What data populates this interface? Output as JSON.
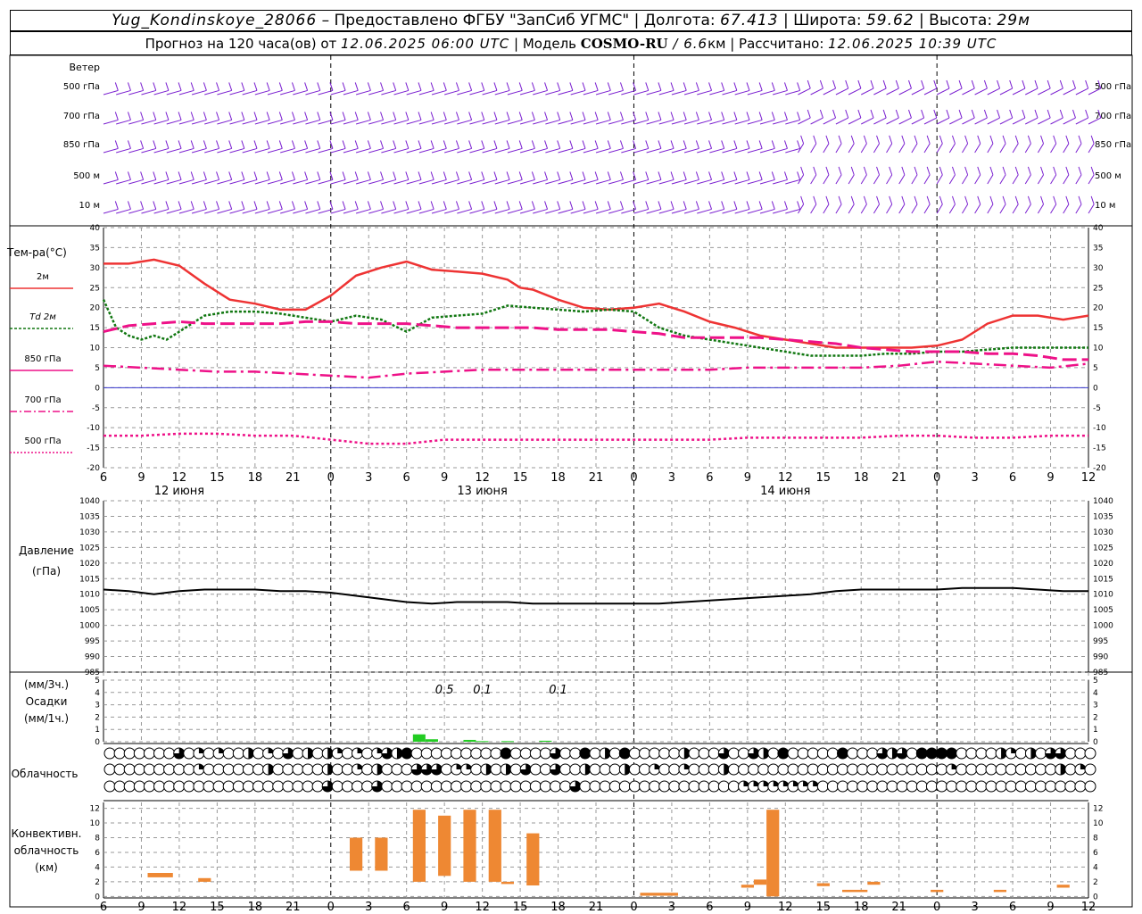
{
  "header": {
    "station": "Yug_Kondinskoye_28066",
    "provider": " – Предоставлено ФГБУ \"ЗапСиб УГМС\" | ",
    "lon_label": "Долгота: ",
    "lon": "67.413",
    "lat_label": " | Широта: ",
    "lat": "59.62",
    "alt_label": " | Высота: ",
    "alt": "29м",
    "forecast_label": "Прогноз на 120 часа(ов) от ",
    "forecast_time": "12.06.2025 06:00 UTC",
    "model_label": " | Модель ",
    "model": "COSMO-RU",
    "resolution": " / 6.6",
    "resolution_unit": "км",
    "calc_label": " | Рассчитано: ",
    "calc_time": "12.06.2025 10:39 UTC"
  },
  "colors": {
    "wind": "#7a1fd0",
    "t2m": "#ee3333",
    "td2m": "#117711",
    "t850": "#ee1188",
    "t700": "#ee1188",
    "t500": "#ee1188",
    "zero": "#3333cc",
    "precip": "#22cc22",
    "conv": "#ee8833",
    "grid": "#999999"
  },
  "labels": {
    "wind_title": "Ветер",
    "wind_levels": [
      "500 гПа",
      "700 гПа",
      "850 гПа",
      "500  м",
      "10  м"
    ],
    "temp_title": "Тем-ра(°C)",
    "legend": [
      "2м",
      "Td  2м",
      "850 гПа",
      "700 гПа",
      "500 гПа"
    ],
    "pressure_title": [
      "Давление",
      "(гПа)"
    ],
    "precip_title": [
      "(мм/3ч.)",
      "Осадки",
      "(мм/1ч.)"
    ],
    "cloud_title": "Облачность",
    "conv_title": [
      "Конвективн.",
      "облачность",
      "(км)"
    ],
    "days": [
      "12 июня",
      "13 июня",
      "14 июня"
    ]
  },
  "chart_data": [
    {
      "type": "line",
      "title": "Тем-ра(°C)",
      "x_hours": [
        0,
        3,
        6,
        9,
        12,
        15,
        18,
        21,
        24,
        27,
        30,
        33,
        36,
        39,
        42,
        45,
        48,
        51,
        54,
        57,
        60,
        63,
        66,
        69,
        72,
        75,
        78
      ],
      "x_ticks": [
        "6",
        "9",
        "12",
        "15",
        "18",
        "21",
        "0",
        "3",
        "6",
        "9",
        "12",
        "15",
        "18",
        "21",
        "0",
        "3",
        "6",
        "9",
        "12",
        "15",
        "18",
        "21",
        "0",
        "3",
        "6",
        "9",
        "12"
      ],
      "ylim": [
        -20,
        40
      ],
      "y_ticks": [
        40,
        35,
        30,
        25,
        20,
        15,
        10,
        5,
        0,
        -5,
        -10,
        -15,
        -20
      ],
      "series": [
        {
          "name": "2м",
          "x": [
            0,
            2,
            4,
            6,
            8,
            10,
            12,
            14,
            16,
            18,
            20,
            22,
            24,
            26,
            28,
            30,
            32,
            33,
            34,
            36,
            38,
            40,
            42,
            44,
            46,
            48,
            50,
            52,
            54,
            56,
            58,
            60,
            62,
            64,
            66,
            68,
            70,
            72,
            74,
            76,
            78
          ],
          "values": [
            31,
            31,
            32,
            30.5,
            26,
            22,
            21,
            19.5,
            19.5,
            23,
            28,
            30,
            31.5,
            29.5,
            29,
            28.5,
            27,
            25,
            24.5,
            22,
            20,
            19.5,
            20,
            21,
            19,
            16.5,
            15,
            13,
            12,
            11,
            10,
            10,
            10,
            10,
            10.5,
            12,
            16,
            18,
            18,
            17,
            18
          ]
        },
        {
          "name": "Td  2м",
          "x": [
            0,
            1,
            2,
            3,
            4,
            5,
            6,
            8,
            10,
            12,
            14,
            16,
            18,
            20,
            22,
            24,
            26,
            28,
            30,
            32,
            34,
            36,
            38,
            40,
            42,
            44,
            46,
            48,
            50,
            52,
            54,
            56,
            58,
            60,
            62,
            64,
            66,
            68,
            70,
            72,
            74,
            76,
            78
          ],
          "values": [
            22,
            15,
            13,
            12,
            13,
            12,
            14,
            18,
            19,
            19,
            18.5,
            17.5,
            16.5,
            18,
            17,
            14,
            17.5,
            18,
            18.5,
            20.5,
            20,
            19.5,
            19,
            19.5,
            19,
            15,
            13,
            12,
            11,
            10,
            9,
            8,
            8,
            8,
            8.5,
            8.5,
            9,
            9,
            9.5,
            10,
            10,
            10,
            10
          ]
        },
        {
          "name": "850 гПа",
          "x": [
            0,
            2,
            4,
            6,
            8,
            10,
            12,
            14,
            16,
            18,
            20,
            22,
            24,
            26,
            28,
            30,
            32,
            34,
            36,
            38,
            40,
            42,
            44,
            46,
            48,
            50,
            52,
            54,
            56,
            58,
            60,
            62,
            64,
            66,
            68,
            70,
            72,
            74,
            76,
            78
          ],
          "values": [
            14,
            15.5,
            16,
            16.5,
            16,
            16,
            16,
            16,
            16.5,
            16.5,
            16,
            16,
            16,
            15.5,
            15,
            15,
            15,
            15,
            14.5,
            14.5,
            14.5,
            14,
            13.5,
            12.5,
            12.5,
            12.5,
            12.5,
            12,
            11.5,
            11,
            10,
            9.5,
            9,
            9,
            9,
            8.5,
            8.5,
            8,
            7,
            7
          ]
        },
        {
          "name": "700 гПа",
          "x": [
            0,
            3,
            6,
            9,
            12,
            15,
            18,
            21,
            24,
            27,
            30,
            33,
            36,
            39,
            42,
            45,
            48,
            51,
            54,
            57,
            60,
            63,
            66,
            69,
            72,
            75,
            78
          ],
          "values": [
            5.5,
            5,
            4.5,
            4,
            4,
            3.5,
            3,
            2.5,
            3.5,
            4,
            4.5,
            4.5,
            4.5,
            4.5,
            4.5,
            4.5,
            4.5,
            5,
            5,
            5,
            5,
            5.5,
            6.5,
            6,
            5.5,
            5,
            6
          ]
        },
        {
          "name": "500 гПа",
          "x": [
            0,
            3,
            6,
            9,
            12,
            15,
            18,
            21,
            24,
            27,
            30,
            33,
            36,
            39,
            42,
            45,
            48,
            51,
            54,
            57,
            60,
            63,
            66,
            69,
            72,
            75,
            78
          ],
          "values": [
            -12,
            -12,
            -11.5,
            -11.5,
            -12,
            -12,
            -13,
            -14,
            -14,
            -13,
            -13,
            -13,
            -13,
            -13,
            -13,
            -13,
            -13,
            -12.5,
            -12.5,
            -12.5,
            -12.5,
            -12,
            -12,
            -12.5,
            -12.5,
            -12,
            -12
          ]
        }
      ]
    },
    {
      "type": "line",
      "title": "Давление (гПа)",
      "ylim": [
        985,
        1040
      ],
      "y_ticks": [
        1040,
        1035,
        1030,
        1025,
        1020,
        1015,
        1010,
        1005,
        1000,
        995,
        990,
        985
      ],
      "x": [
        0,
        2,
        4,
        6,
        8,
        10,
        12,
        14,
        16,
        18,
        20,
        22,
        24,
        26,
        28,
        30,
        32,
        34,
        36,
        38,
        40,
        42,
        44,
        46,
        48,
        50,
        52,
        54,
        56,
        58,
        60,
        62,
        64,
        66,
        68,
        70,
        72,
        74,
        76,
        78
      ],
      "values": [
        1011.5,
        1011,
        1010,
        1011,
        1011.5,
        1011.5,
        1011.5,
        1011,
        1011,
        1010.5,
        1009.5,
        1008.5,
        1007.5,
        1007,
        1007.5,
        1007.5,
        1007.5,
        1007,
        1007,
        1007,
        1007,
        1007,
        1007,
        1007.5,
        1008,
        1008.5,
        1009,
        1009.5,
        1010,
        1011,
        1011.5,
        1011.5,
        1011.5,
        1011.5,
        1012,
        1012,
        1012,
        1011.5,
        1011,
        1011
      ]
    },
    {
      "type": "bar",
      "title": "Осадки",
      "ylim": [
        0,
        5
      ],
      "y_ticks": [
        5,
        4,
        3,
        2,
        1,
        0
      ],
      "x_hours": [
        25,
        26,
        29,
        30,
        32,
        35
      ],
      "values": [
        0.6,
        0.2,
        0.15,
        0.05,
        0.05,
        0.08
      ],
      "annotations": [
        {
          "x": 27,
          "text": "0.5"
        },
        {
          "x": 30,
          "text": "0.1"
        },
        {
          "x": 36,
          "text": "0.1"
        }
      ]
    },
    {
      "type": "bar",
      "title": "Конвективн. облачность (км)",
      "ylim": [
        0,
        12
      ],
      "y_ticks": [
        12,
        10,
        8,
        6,
        4,
        2,
        0
      ],
      "bars": [
        {
          "x0": 3.5,
          "x1": 5.5,
          "bottom": 2.6,
          "top": 3.2
        },
        {
          "x0": 7.5,
          "x1": 8.5,
          "bottom": 2.0,
          "top": 2.5
        },
        {
          "x0": 19.5,
          "x1": 20.5,
          "bottom": 3.5,
          "top": 8.0
        },
        {
          "x0": 21.5,
          "x1": 22.5,
          "bottom": 3.5,
          "top": 8.0
        },
        {
          "x0": 24.5,
          "x1": 25.5,
          "bottom": 2.0,
          "top": 11.8
        },
        {
          "x0": 26.5,
          "x1": 27.5,
          "bottom": 2.8,
          "top": 11.0
        },
        {
          "x0": 28.5,
          "x1": 29.5,
          "bottom": 2.0,
          "top": 11.8
        },
        {
          "x0": 30.5,
          "x1": 31.5,
          "bottom": 2.0,
          "top": 11.8
        },
        {
          "x0": 31.5,
          "x1": 32.5,
          "bottom": 1.7,
          "top": 2.0
        },
        {
          "x0": 33.5,
          "x1": 34.5,
          "bottom": 1.5,
          "top": 8.6
        },
        {
          "x0": 42.5,
          "x1": 45.5,
          "bottom": 0.1,
          "top": 0.5
        },
        {
          "x0": 50.5,
          "x1": 51.5,
          "bottom": 1.2,
          "top": 1.6
        },
        {
          "x0": 51.5,
          "x1": 52.5,
          "bottom": 1.6,
          "top": 2.3
        },
        {
          "x0": 52.5,
          "x1": 53.5,
          "bottom": 0.0,
          "top": 11.8
        },
        {
          "x0": 56.5,
          "x1": 57.5,
          "bottom": 1.4,
          "top": 1.8
        },
        {
          "x0": 58.5,
          "x1": 60.5,
          "bottom": 0.6,
          "top": 0.9
        },
        {
          "x0": 60.5,
          "x1": 61.5,
          "bottom": 1.6,
          "top": 2.0
        },
        {
          "x0": 65.5,
          "x1": 66.5,
          "bottom": 0.6,
          "top": 0.9
        },
        {
          "x0": 70.5,
          "x1": 71.5,
          "bottom": 0.6,
          "top": 0.9
        },
        {
          "x0": 75.5,
          "x1": 76.5,
          "bottom": 1.2,
          "top": 1.6
        }
      ]
    }
  ],
  "clouds": {
    "rows": [
      "0000000000000000000000000000000000000000000000000000000000000000000000000000000000000000000000000000",
      "0000000000000000000000000000000000000000000000000000000000000000000000000000000000000000000000000000",
      "0000000000000000000000000000000000000000000000000000000000000000000000000000000000000000000000000000"
    ],
    "fill_runs": [
      [
        [
          7,
          3
        ],
        [
          9,
          1
        ],
        [
          11,
          1
        ],
        [
          14,
          2
        ],
        [
          16,
          1
        ],
        [
          18,
          3
        ],
        [
          20,
          2
        ],
        [
          22,
          2
        ],
        [
          23,
          1
        ],
        [
          25,
          1
        ],
        [
          27,
          1
        ],
        [
          28,
          3
        ],
        [
          29,
          2
        ],
        [
          30,
          4
        ],
        [
          40,
          4
        ],
        [
          45,
          3
        ],
        [
          48,
          4
        ],
        [
          50,
          2
        ],
        [
          52,
          4
        ],
        [
          58,
          2
        ],
        [
          62,
          3
        ],
        [
          65,
          3
        ],
        [
          66,
          2
        ],
        [
          68,
          4
        ],
        [
          74,
          4
        ],
        [
          78,
          3
        ],
        [
          79,
          2
        ],
        [
          80,
          3
        ],
        [
          82,
          4
        ],
        [
          83,
          4
        ],
        [
          84,
          4
        ],
        [
          85,
          4
        ],
        [
          90,
          2
        ],
        [
          91,
          1
        ],
        [
          93,
          2
        ],
        [
          95,
          3
        ],
        [
          96,
          3
        ]
      ],
      [
        [
          9,
          1
        ],
        [
          16,
          2
        ],
        [
          22,
          2
        ],
        [
          25,
          1
        ],
        [
          27,
          2
        ],
        [
          31,
          3
        ],
        [
          32,
          3
        ],
        [
          33,
          3
        ],
        [
          35,
          1
        ],
        [
          36,
          1
        ],
        [
          38,
          2
        ],
        [
          40,
          2
        ],
        [
          42,
          3
        ],
        [
          45,
          3
        ],
        [
          48,
          2
        ],
        [
          52,
          2
        ],
        [
          55,
          1
        ],
        [
          58,
          1
        ],
        [
          62,
          2
        ],
        [
          85,
          1
        ],
        [
          96,
          2
        ],
        [
          98,
          1
        ]
      ],
      [
        [
          22,
          3
        ],
        [
          27,
          3
        ],
        [
          47,
          3
        ],
        [
          64,
          1
        ],
        [
          65,
          1
        ],
        [
          66,
          1
        ],
        [
          67,
          1
        ],
        [
          68,
          1
        ],
        [
          69,
          1
        ],
        [
          70,
          1
        ],
        [
          71,
          1
        ]
      ]
    ]
  }
}
